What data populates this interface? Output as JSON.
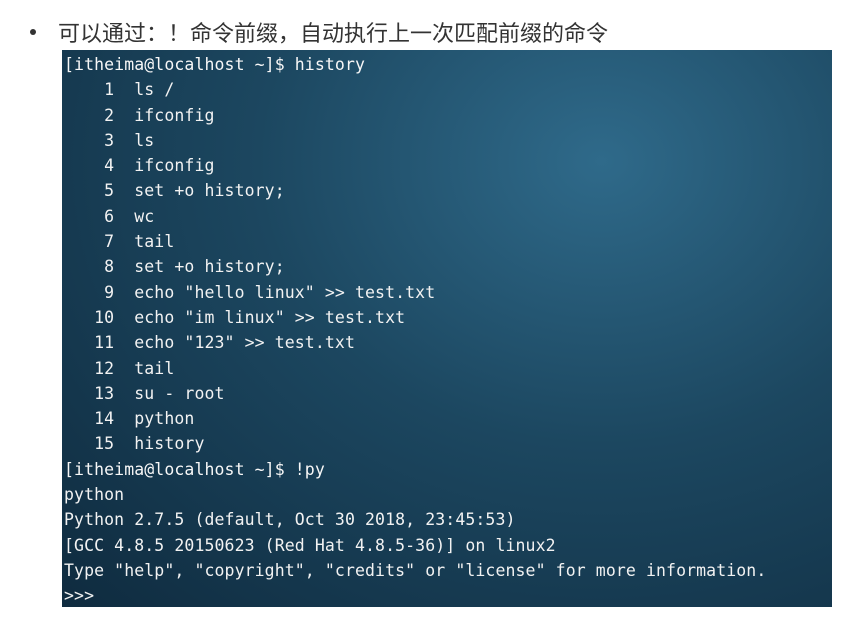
{
  "heading": {
    "bullet": "•",
    "text": "可以通过：！命令前缀，自动执行上一次匹配前缀的命令"
  },
  "terminal": {
    "lines": [
      "[itheima@localhost ~]$ history",
      "    1  ls /",
      "    2  ifconfig",
      "    3  ls",
      "    4  ifconfig",
      "    5  set +o history;",
      "    6  wc",
      "    7  tail",
      "    8  set +o history;",
      "    9  echo \"hello linux\" >> test.txt",
      "   10  echo \"im linux\" >> test.txt",
      "   11  echo \"123\" >> test.txt",
      "   12  tail",
      "   13  su - root",
      "   14  python",
      "   15  history",
      "[itheima@localhost ~]$ !py",
      "python",
      "Python 2.7.5 (default, Oct 30 2018, 23:45:53)",
      "[GCC 4.8.5 20150623 (Red Hat 4.8.5-36)] on linux2",
      "Type \"help\", \"copyright\", \"credits\" or \"license\" for more information.",
      ">>> "
    ]
  }
}
